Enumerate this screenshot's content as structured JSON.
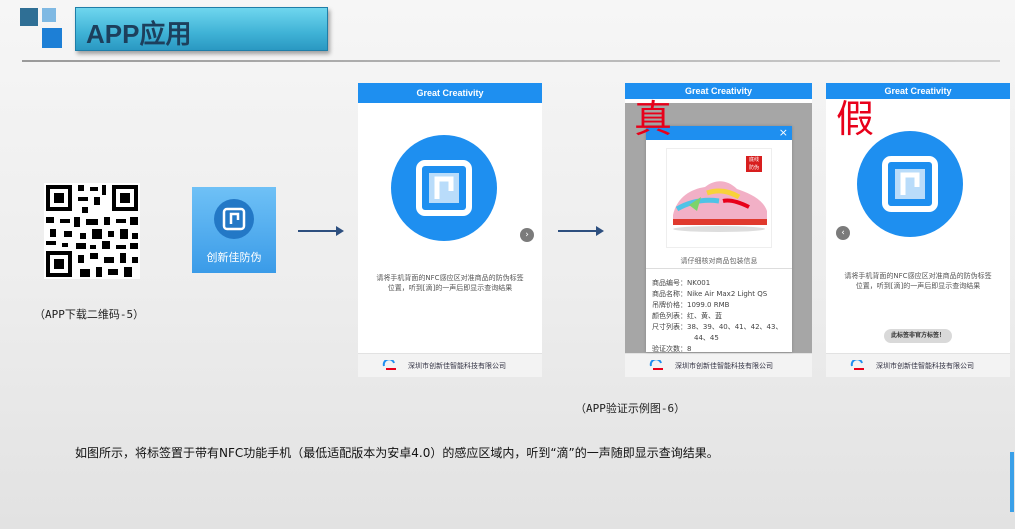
{
  "header": {
    "title": "APP应用"
  },
  "qr": {
    "caption": "（APP下载二维码-5）"
  },
  "app_icon": {
    "label": "创新佳防伪"
  },
  "phones": {
    "bar_title": "Great Creativity",
    "instruction_line1": "请将手机背面的NFC感应区对准商品的防伪标签",
    "instruction_line2": "位置，听到[滴]的一声后即显示查询结果",
    "footer_company": "深圳市创新佳智能科技有限公司"
  },
  "genuine": {
    "mark": "真",
    "stamp_text": "底线 防伪",
    "hint": "请仔细核对商品包装信息",
    "info": [
      {
        "key": "商品编号：",
        "value": "NK001"
      },
      {
        "key": "商品名称：",
        "value": "Nike Air Max2 Light QS"
      },
      {
        "key": "吊牌价格：",
        "value": "1099.0 RMB"
      },
      {
        "key": "颜色列表：",
        "value": "红、黄、蓝"
      },
      {
        "key": "尺寸列表：",
        "value": "38、39、40、41、42、43、"
      },
      {
        "key": "",
        "value": "44、45"
      },
      {
        "key": "验证次数：",
        "value": "8"
      }
    ],
    "close_symbol": "×"
  },
  "fake": {
    "mark": "假",
    "badge": "此标签非官方标签！"
  },
  "caption2": "（APP验证示例图-6）",
  "description": "如图所示，将标签置于带有NFC功能手机（最低适配版本为安卓4.0）的感应区域内，听到“滴”的一声随即显示查询结果。",
  "colors": {
    "accent": "#1e8ff0",
    "mark_red": "#e8001a",
    "title_bg": "#3fb2d6"
  },
  "icons": [
    "nfc-icon",
    "qr-code-icon",
    "arrow-right-icon",
    "chevron-left-icon",
    "chevron-right-icon",
    "close-icon",
    "company-logo-icon"
  ]
}
